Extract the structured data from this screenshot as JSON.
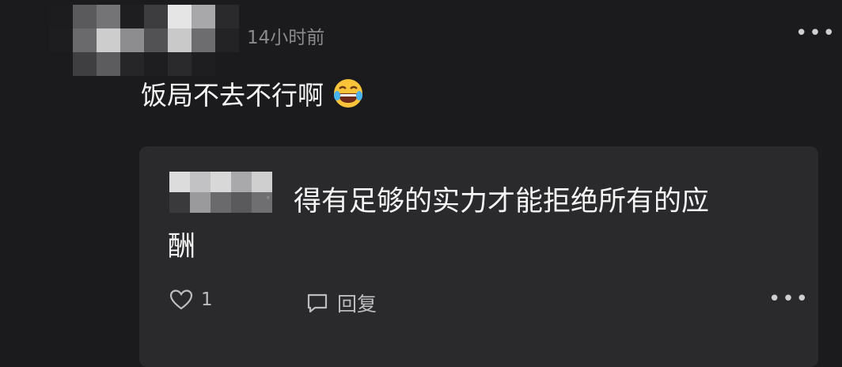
{
  "comment": {
    "timestamp": "14小时前",
    "text": "饭局不去不行啊",
    "emoji": "laughing-with-tears-emoji",
    "more_icon": "more-horizontal-icon"
  },
  "reply": {
    "line1": "得有足够的实力才能拒绝所有的应",
    "line2": "酬",
    "likes": "1",
    "reply_label": "回复",
    "more_icon": "more-horizontal-icon"
  },
  "colors": {
    "background": "#1b1b1d",
    "reply_background": "#2a2a2c",
    "muted_text": "#8a8a8e"
  }
}
